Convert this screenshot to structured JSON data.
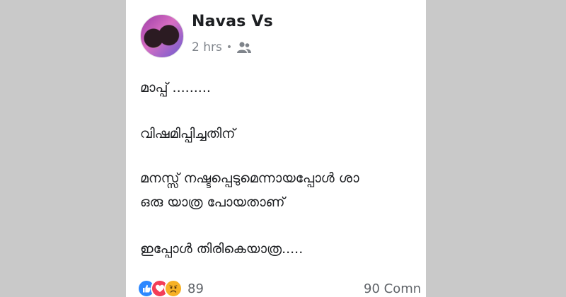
{
  "post": {
    "author": "Navas Vs",
    "time": "2 hrs",
    "separator": "•",
    "audience_icon": "friends-icon",
    "lines": [
      "മാപ്പ് .........",
      "വിഷമിപ്പിച്ചതിന്",
      "മനസ്സ് നഷ്ടപ്പെടുമെന്നായപ്പോൾ ശാ",
      "ഒരു യാത്ര പോയതാണ്",
      "ഇപ്പോൾ തിരികെയാത്ര....."
    ]
  },
  "footer": {
    "reaction_icons": [
      "like-icon",
      "love-icon",
      "sad-icon"
    ],
    "reaction_count": "89",
    "comments": "90 Comn"
  },
  "colors": {
    "background": "#c9c9c9",
    "card": "#ffffff",
    "like": "#2d88ff",
    "love": "#f33e58",
    "sad": "#f7b125"
  }
}
